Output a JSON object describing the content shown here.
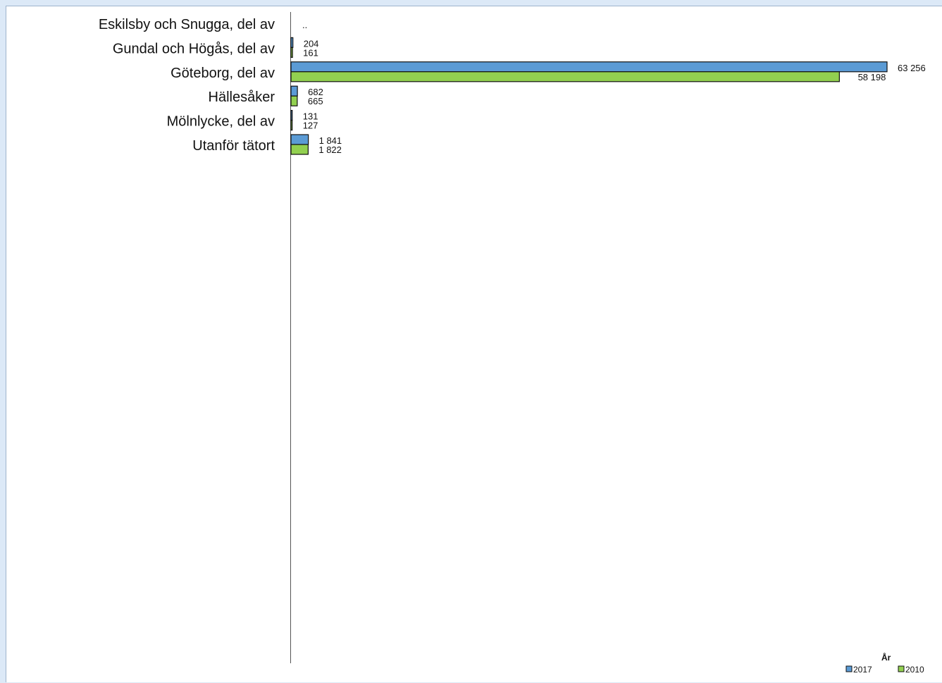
{
  "chart_data": {
    "type": "bar",
    "orientation": "horizontal",
    "categories": [
      "Eskilsby och Snugga, del av",
      "Gundal och Högås, del av",
      "Göteborg, del av",
      "Hällesåker",
      "Mölnlycke, del av",
      "Utanför tätort"
    ],
    "series": [
      {
        "name": "2017",
        "color": "#5b9bd5",
        "values": [
          null,
          204,
          63256,
          682,
          131,
          1841
        ],
        "labels": [
          "..",
          "204",
          "63 256",
          "682",
          "131",
          "1 841"
        ]
      },
      {
        "name": "2010",
        "color": "#92d050",
        "values": [
          null,
          161,
          58198,
          665,
          127,
          1822
        ],
        "labels": [
          "",
          "161",
          "58 198",
          "665",
          "127",
          "1 822"
        ]
      }
    ],
    "xlim": [
      0,
      63256
    ],
    "grid": false,
    "legend": {
      "title": "År",
      "placement": "bottom-right"
    }
  }
}
